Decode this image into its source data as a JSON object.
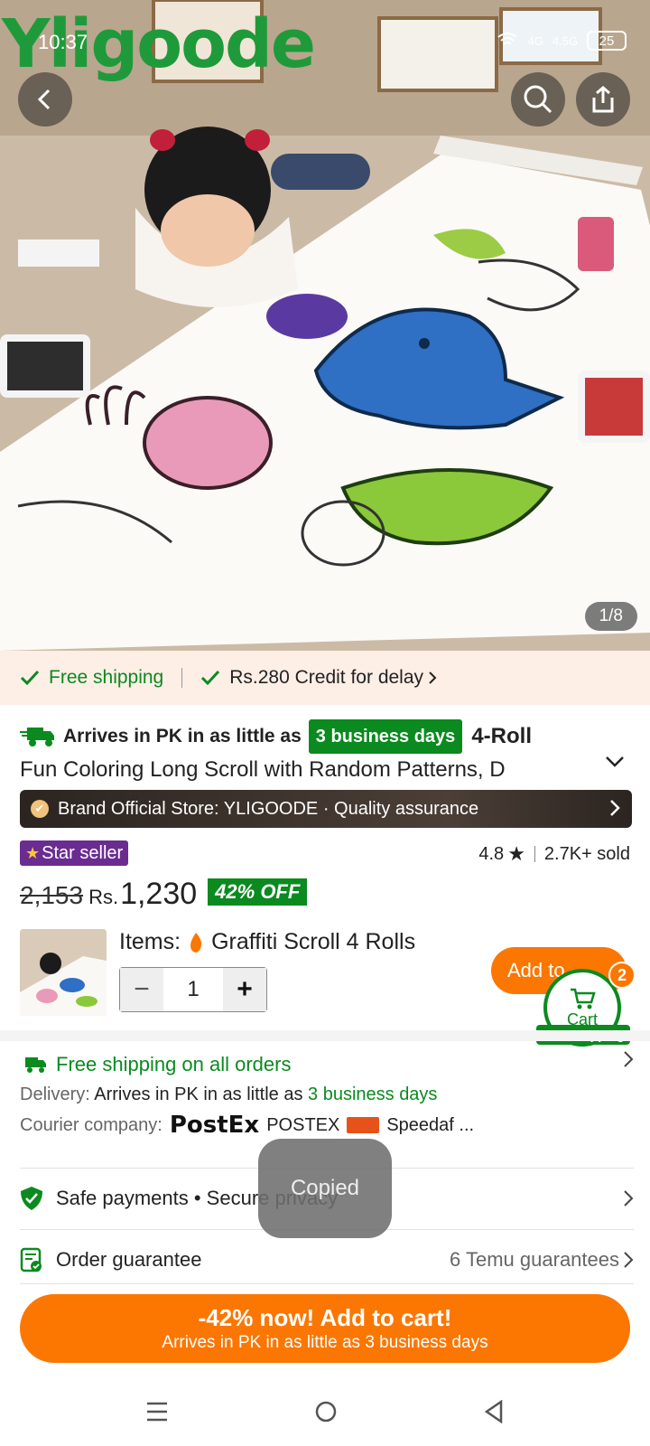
{
  "status_bar": {
    "time": "10:37",
    "network1": "4G",
    "network2": "4.5G",
    "battery": "25"
  },
  "hero": {
    "brand_logo": "Yligoode",
    "image_counter": "1/8"
  },
  "shipping_banner": {
    "free_shipping": "Free shipping",
    "credit": "Rs.280 Credit for delay"
  },
  "title": {
    "arrive_prefix": "Arrives in PK in as little as",
    "days_badge": "3 business days",
    "title_start": "4-Roll",
    "title_line2": "Fun Coloring Long Scroll with Random Patterns, D"
  },
  "store": {
    "label": "Brand Official Store: YLIGOODE · Quality assurance"
  },
  "badges": {
    "star_seller": "Star seller",
    "rating": "4.8",
    "sold": "2.7K+ sold"
  },
  "price": {
    "original": "2,153",
    "currency": "Rs.",
    "current": "1,230",
    "discount": "42% OFF"
  },
  "item": {
    "items_label": "Items:",
    "variant": "Graffiti Scroll 4 Rolls",
    "quantity": "1",
    "add_button": "Add to"
  },
  "cart": {
    "label": "Cart",
    "count": "2",
    "free_shipping": "Free shipping"
  },
  "shipping_info": {
    "free_all": "Free shipping on all orders",
    "delivery_label": "Delivery:",
    "delivery_text": "Arrives in PK in as little as",
    "delivery_days": "3 business days",
    "courier_label": "Courier company:",
    "courier1_logo": "PostEx",
    "courier1_name": "POSTEX",
    "courier2_name": "Speedaf ..."
  },
  "safe_payments": {
    "label": "Safe payments • Secure privacy"
  },
  "order_guarantee": {
    "label": "Order guarantee",
    "right": "6 Temu guarantees"
  },
  "toast": {
    "text": "Copied"
  },
  "cta": {
    "line1": "-42% now! Add to cart!",
    "line2": "Arrives in PK in as little as 3 business days"
  },
  "colors": {
    "accent_orange": "#fb7701",
    "accent_green": "#0a8a1f",
    "star_purple": "#6a2c91"
  }
}
